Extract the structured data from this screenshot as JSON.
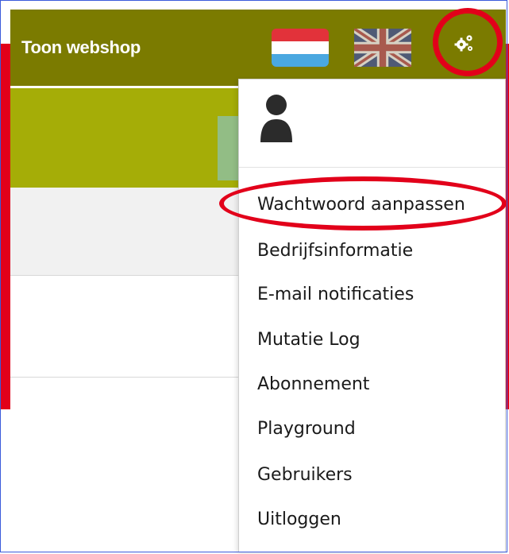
{
  "navbar": {
    "brand": "Toon webshop",
    "languages": [
      {
        "name": "flag-nl-icon"
      },
      {
        "name": "flag-uk-icon"
      }
    ],
    "settings_icon": "gears-icon"
  },
  "colors": {
    "navbar_bg": "#7b7b00",
    "banner_bg": "#a5ad07",
    "annotation_red": "#e2001a"
  },
  "dropdown": {
    "user_icon": "user-icon",
    "items": [
      {
        "label": "Wachtwoord aanpassen"
      },
      {
        "label": "Bedrijfsinformatie"
      },
      {
        "label": "E-mail notificaties"
      },
      {
        "label": "Mutatie Log"
      },
      {
        "label": "Abonnement"
      },
      {
        "label": "Playground"
      },
      {
        "label": "Gebruikers"
      },
      {
        "label": "Uitloggen"
      }
    ]
  }
}
